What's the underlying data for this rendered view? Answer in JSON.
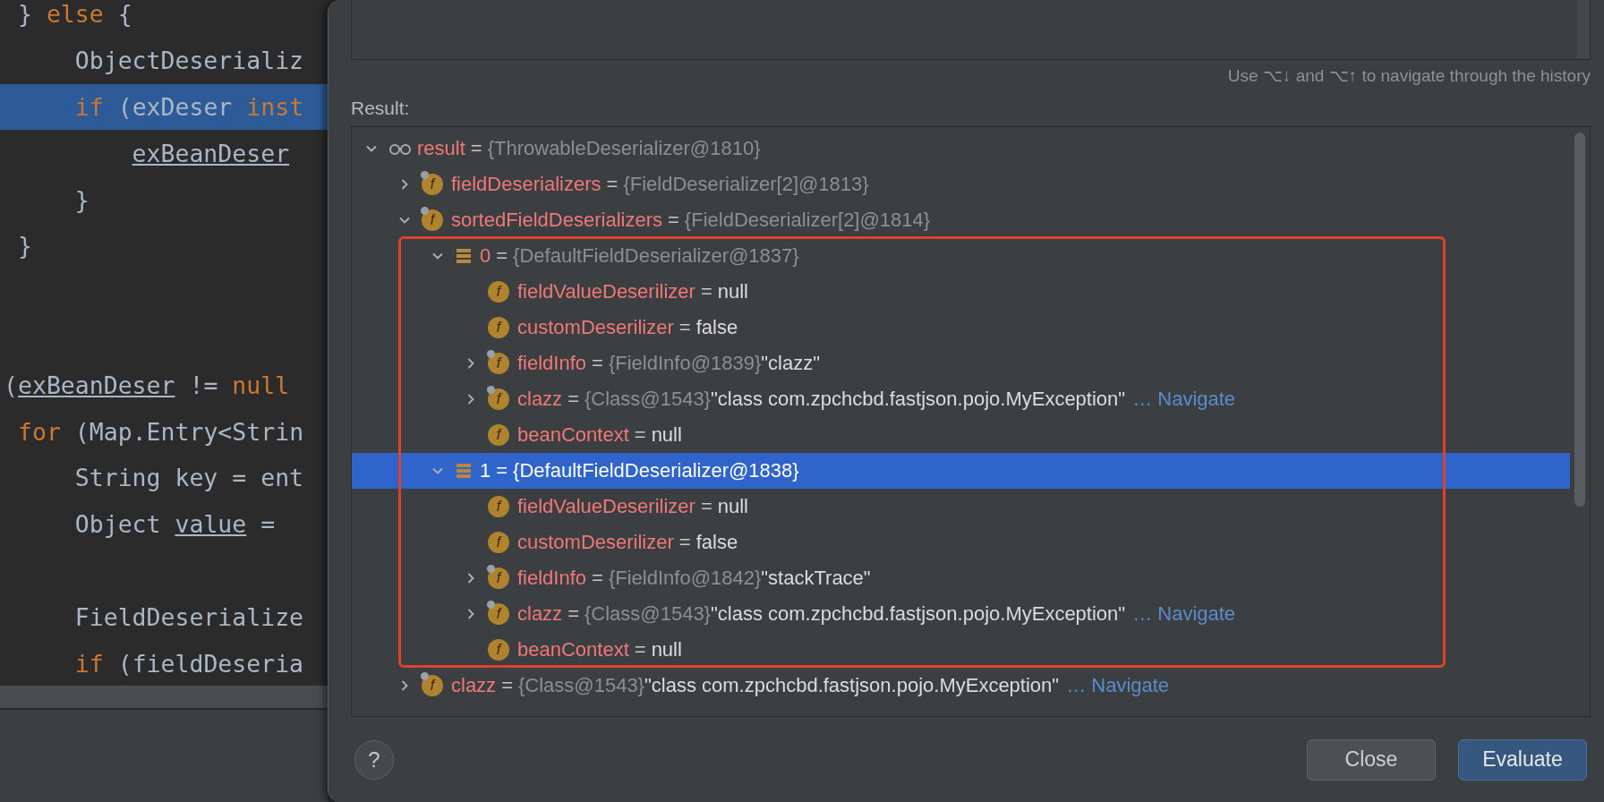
{
  "editor": {
    "lines": [
      {
        "highlighted": false,
        "segments": [
          {
            "kind": "plain",
            "text": " } "
          },
          {
            "kind": "keyword",
            "text": "else"
          },
          {
            "kind": "plain",
            "text": " {"
          }
        ]
      },
      {
        "highlighted": false,
        "segments": [
          {
            "kind": "plain",
            "text": "     ObjectDeserializ"
          }
        ]
      },
      {
        "highlighted": true,
        "segments": [
          {
            "kind": "keyword",
            "text": "     if"
          },
          {
            "kind": "plain",
            "text": " (exDeser "
          },
          {
            "kind": "keyword",
            "text": "inst"
          }
        ]
      },
      {
        "highlighted": false,
        "segments": [
          {
            "kind": "underlined",
            "text": "         exBeanDeser"
          }
        ]
      },
      {
        "highlighted": false,
        "segments": [
          {
            "kind": "plain",
            "text": "     }"
          }
        ]
      },
      {
        "highlighted": false,
        "segments": [
          {
            "kind": "plain",
            "text": " }"
          }
        ]
      },
      {
        "highlighted": false
      },
      {
        "highlighted": false
      },
      {
        "highlighted": false,
        "segments": [
          {
            "kind": "plain",
            "text": "("
          },
          {
            "kind": "underlined",
            "text": "exBeanDeser"
          },
          {
            "kind": "plain",
            "text": " != "
          },
          {
            "kind": "keyword",
            "text": "null"
          }
        ]
      },
      {
        "highlighted": false,
        "segments": [
          {
            "kind": "keyword",
            "text": " for"
          },
          {
            "kind": "plain",
            "text": " (Map.Entry<Strin"
          }
        ]
      },
      {
        "highlighted": false,
        "segments": [
          {
            "kind": "plain",
            "text": "     String key = ent"
          }
        ]
      },
      {
        "highlighted": false,
        "segments": [
          {
            "kind": "plain",
            "text": "     Object "
          },
          {
            "kind": "underlined",
            "text": "value"
          },
          {
            "kind": "plain",
            "text": " = "
          }
        ]
      },
      {
        "highlighted": false
      },
      {
        "highlighted": false,
        "segments": [
          {
            "kind": "plain",
            "text": "     FieldDeserialize"
          }
        ]
      },
      {
        "highlighted": false,
        "segments": [
          {
            "kind": "keyword",
            "text": "     if"
          },
          {
            "kind": "plain",
            "text": " (fieldDeseria"
          }
        ]
      }
    ]
  },
  "dialog": {
    "history_hint": "Use ⌥↓ and ⌥↑ to navigate through the history",
    "result_label": "Result:",
    "tree": [
      {
        "kind": "watch",
        "name": "result",
        "sep": "=",
        "type": "{ThrowableDeserializer@1810}",
        "selected": false,
        "expanded": true,
        "children": [
          {
            "kind": "field",
            "icon_letter": "f",
            "marked": true,
            "name": "fieldDeserializers",
            "sep": "=",
            "type": "{FieldDeserializer[2]@1813}",
            "selected": false,
            "expanded": false
          },
          {
            "kind": "field",
            "icon_letter": "f",
            "marked": true,
            "name": "sortedFieldDeserializers",
            "sep": "=",
            "type": "{FieldDeserializer[2]@1814}",
            "selected": false,
            "expanded": true,
            "children": [
              {
                "kind": "array-item",
                "name": "0",
                "sep": "=",
                "type": "{DefaultFieldDeserializer@1837}",
                "selected": false,
                "expanded": true,
                "children": [
                  {
                    "kind": "field",
                    "icon_letter": "f",
                    "marked": false,
                    "name": "fieldValueDeserilizer",
                    "sep": "=",
                    "value": "null",
                    "selected": false
                  },
                  {
                    "kind": "field",
                    "icon_letter": "f",
                    "marked": false,
                    "name": "customDeserilizer",
                    "sep": "=",
                    "value": "false",
                    "selected": false
                  },
                  {
                    "kind": "field",
                    "icon_letter": "f",
                    "marked": true,
                    "name": "fieldInfo",
                    "sep": "=",
                    "type": "{FieldInfo@1839}",
                    "value": "\"clazz\"",
                    "selected": false,
                    "expanded": false
                  },
                  {
                    "kind": "field",
                    "icon_letter": "f",
                    "marked": true,
                    "name": "clazz",
                    "sep": "=",
                    "type": "{Class@1543}",
                    "value": "\"class com.zpchcbd.fastjson.pojo.MyException\"",
                    "link": "… Navigate",
                    "selected": false,
                    "expanded": false
                  },
                  {
                    "kind": "field",
                    "icon_letter": "f",
                    "marked": false,
                    "name": "beanContext",
                    "sep": "=",
                    "value": "null",
                    "selected": false
                  }
                ]
              },
              {
                "kind": "array-item",
                "name": "1",
                "sep": "=",
                "type": "{DefaultFieldDeserializer@1838}",
                "selected": true,
                "expanded": true,
                "children": [
                  {
                    "kind": "field",
                    "icon_letter": "f",
                    "marked": false,
                    "name": "fieldValueDeserilizer",
                    "sep": "=",
                    "value": "null",
                    "selected": false
                  },
                  {
                    "kind": "field",
                    "icon_letter": "f",
                    "marked": false,
                    "name": "customDeserilizer",
                    "sep": "=",
                    "value": "false",
                    "selected": false
                  },
                  {
                    "kind": "field",
                    "icon_letter": "f",
                    "marked": true,
                    "name": "fieldInfo",
                    "sep": "=",
                    "type": "{FieldInfo@1842}",
                    "value": "\"stackTrace\"",
                    "selected": false,
                    "expanded": false
                  },
                  {
                    "kind": "field",
                    "icon_letter": "f",
                    "marked": true,
                    "name": "clazz",
                    "sep": "=",
                    "type": "{Class@1543}",
                    "value": "\"class com.zpchcbd.fastjson.pojo.MyException\"",
                    "link": "… Navigate",
                    "selected": false,
                    "expanded": false
                  },
                  {
                    "kind": "field",
                    "icon_letter": "f",
                    "marked": false,
                    "name": "beanContext",
                    "sep": "=",
                    "value": "null",
                    "selected": false
                  }
                ]
              }
            ]
          },
          {
            "kind": "field",
            "icon_letter": "f",
            "marked": true,
            "name": "clazz",
            "sep": "=",
            "type": "{Class@1543}",
            "value": "\"class com.zpchcbd.fastjson.pojo.MyException\"",
            "link": "… Navigate",
            "selected": false,
            "expanded": false
          }
        ]
      }
    ],
    "buttons": [
      {
        "kind": "secondary",
        "label": "Close"
      },
      {
        "kind": "primary",
        "label": "Evaluate"
      }
    ],
    "help": "?"
  }
}
